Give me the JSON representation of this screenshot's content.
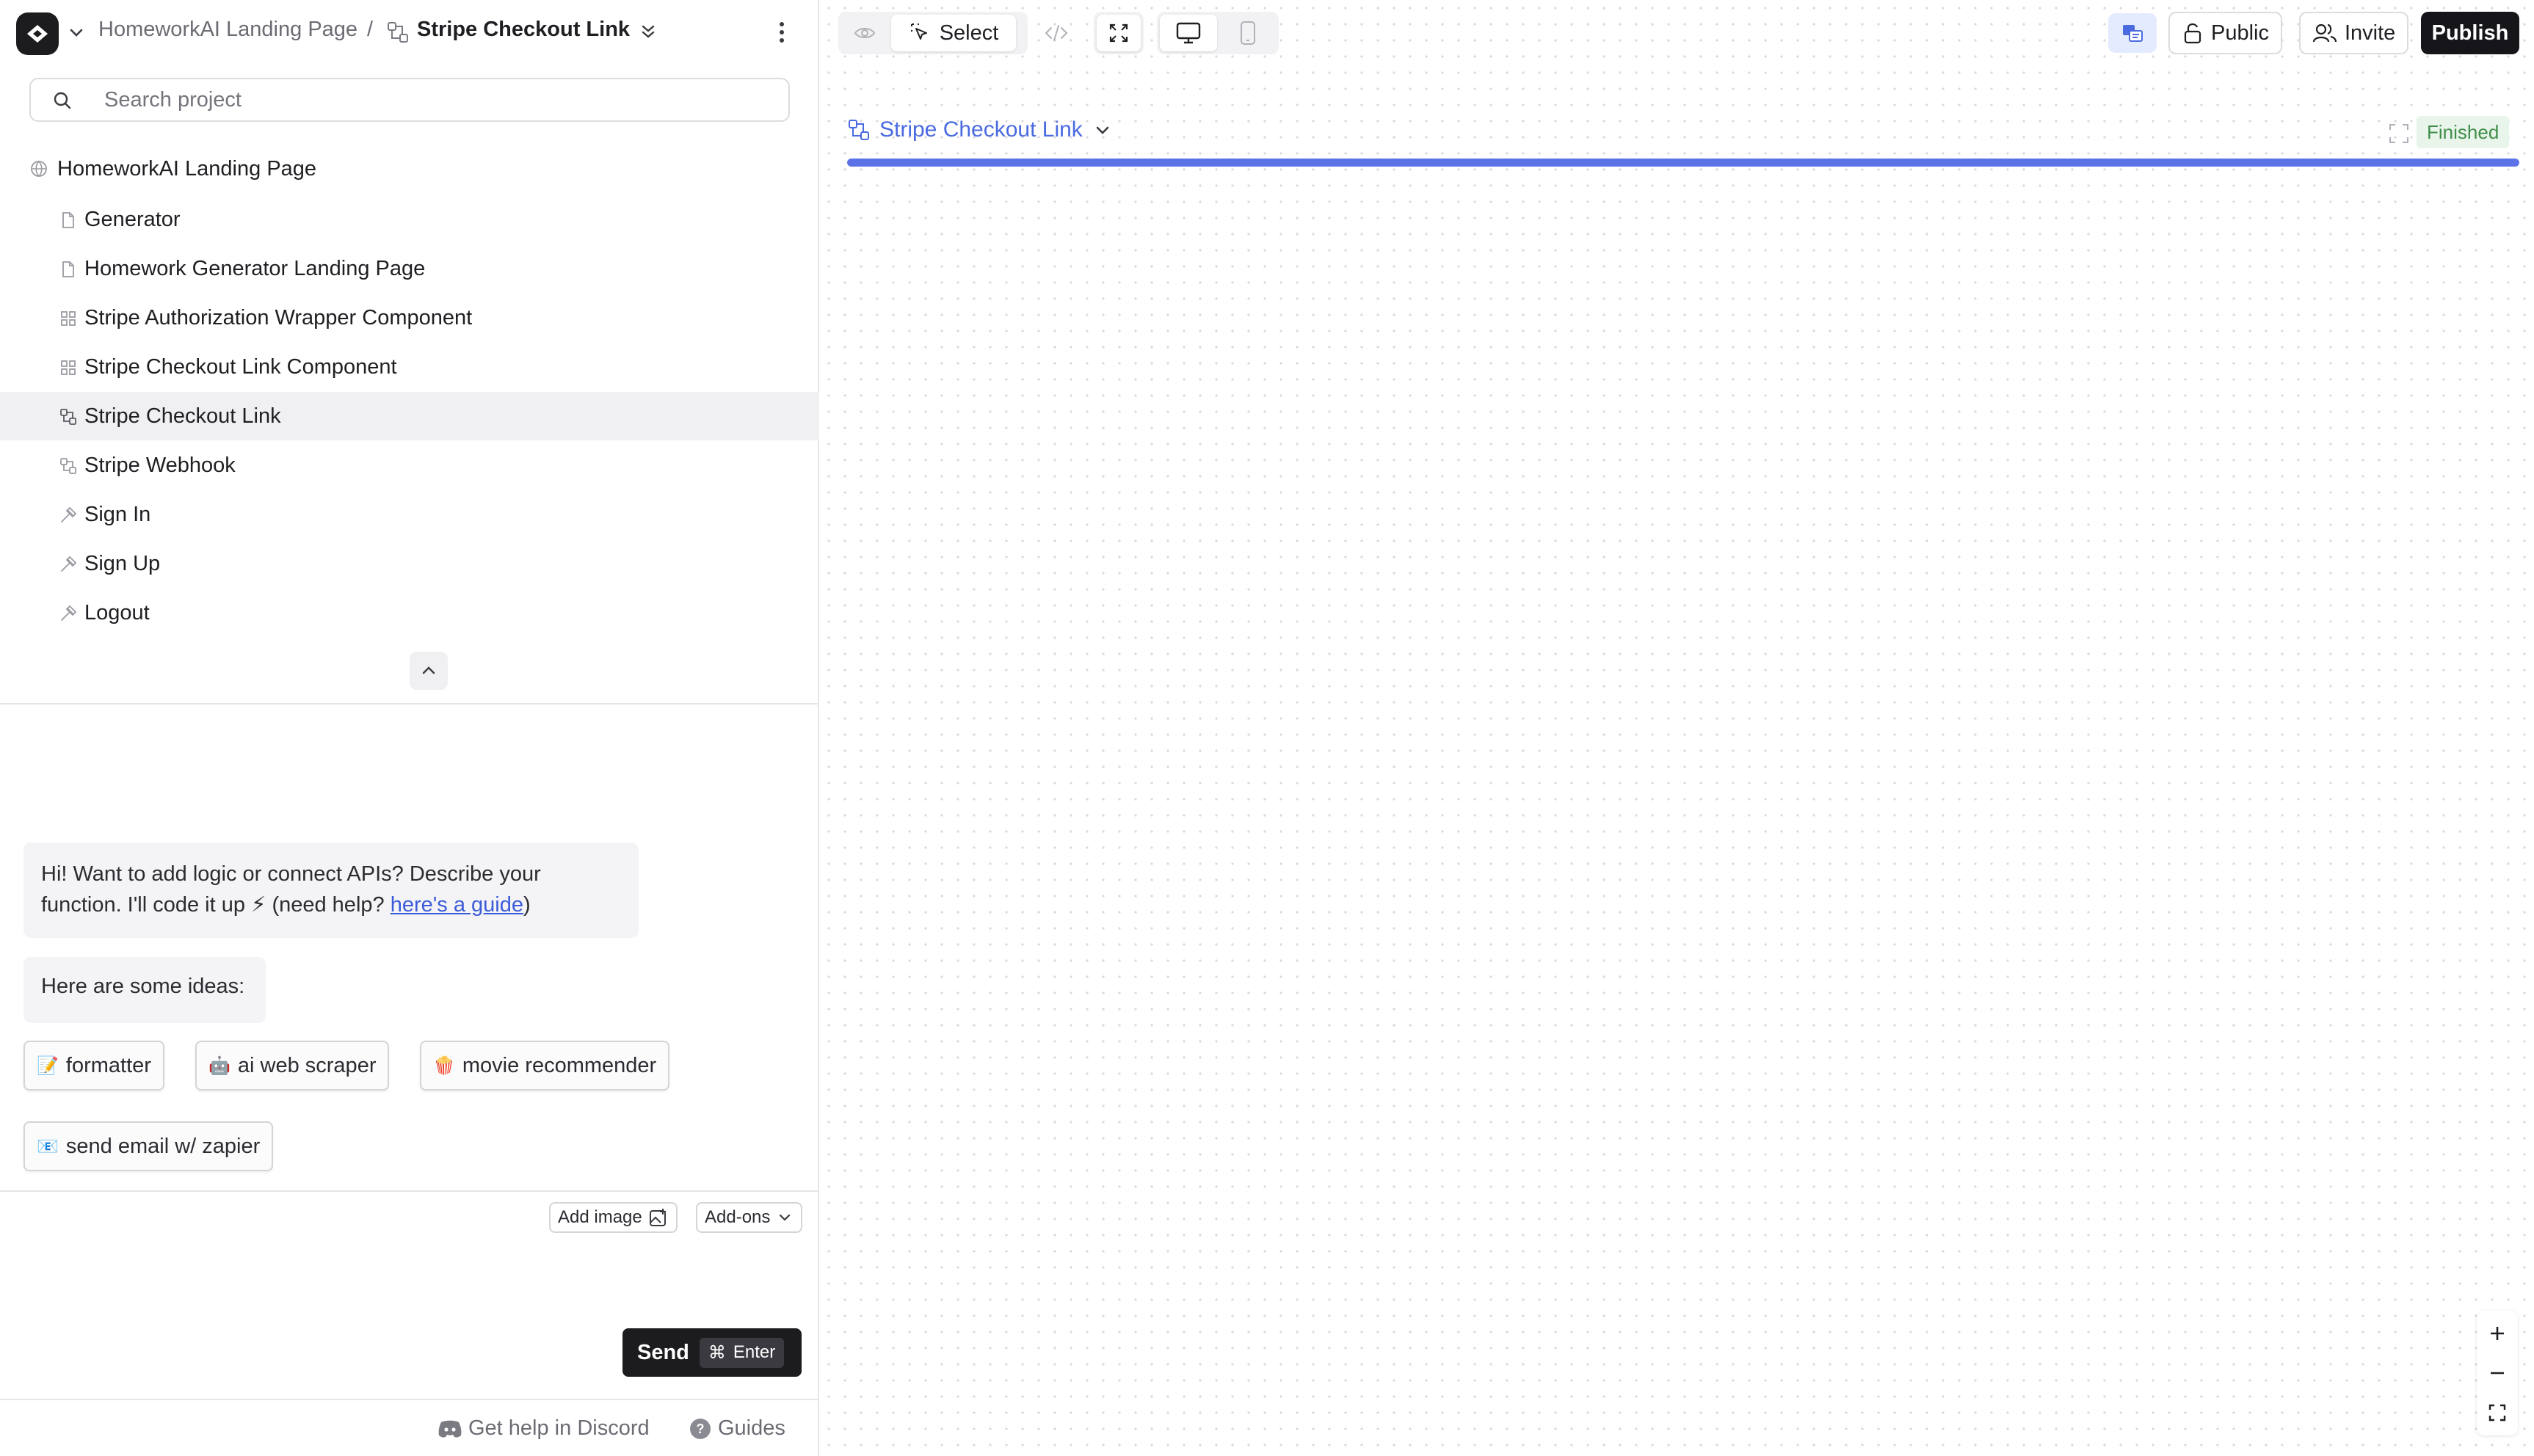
{
  "breadcrumb": {
    "project": "HomeworkAI Landing Page",
    "separator": "/",
    "current": "Stripe Checkout Link"
  },
  "search": {
    "placeholder": "Search project",
    "value": ""
  },
  "tree": {
    "root": "HomeworkAI Landing Page",
    "items": [
      {
        "label": "Generator",
        "icon": "page-icon",
        "active": false
      },
      {
        "label": "Homework Generator Landing Page",
        "icon": "page-icon",
        "active": false
      },
      {
        "label": "Stripe Authorization Wrapper Component",
        "icon": "component-icon",
        "active": false
      },
      {
        "label": "Stripe Checkout Link Component",
        "icon": "component-icon",
        "active": false
      },
      {
        "label": "Stripe Checkout Link",
        "icon": "function-icon",
        "active": true
      },
      {
        "label": "Stripe Webhook",
        "icon": "function-icon",
        "active": false
      },
      {
        "label": "Sign In",
        "icon": "auth-icon",
        "active": false
      },
      {
        "label": "Sign Up",
        "icon": "auth-icon",
        "active": false
      },
      {
        "label": "Logout",
        "icon": "auth-icon",
        "active": false
      }
    ]
  },
  "chat": {
    "intro_text": "Hi! Want to add logic or connect APIs? Describe your function. I'll code it up ⚡ (need help? ",
    "intro_link": "here's a guide",
    "intro_close": ")",
    "ideas_header": "Here are some ideas:",
    "ideas": [
      {
        "emoji": "📝",
        "label": "formatter"
      },
      {
        "emoji": "🤖",
        "label": "ai web scraper"
      },
      {
        "emoji": "🍿",
        "label": "movie recommender"
      },
      {
        "emoji": "📧",
        "label": "send email w/ zapier"
      }
    ]
  },
  "composer": {
    "add_image": "Add image",
    "addons": "Add-ons",
    "placeholder": "",
    "send_label": "Send",
    "shortcut_symbol": "⌘",
    "shortcut_key": "Enter"
  },
  "footer": {
    "discord": "Get help in Discord",
    "guides": "Guides"
  },
  "toolbar": {
    "select_label": "Select",
    "public_label": "Public",
    "invite_label": "Invite",
    "publish_label": "Publish"
  },
  "canvas": {
    "node_title": "Stripe Checkout Link",
    "status": "Finished",
    "progress_fraction": 1.0
  },
  "colors": {
    "accent": "#5c73e8",
    "status_green": "#3f8e4a",
    "dark": "#1c1c1f"
  }
}
